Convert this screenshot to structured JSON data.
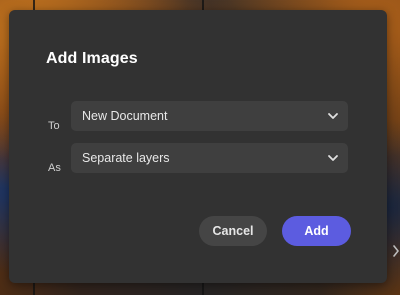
{
  "dialog": {
    "title": "Add Images",
    "fields": [
      {
        "label": "To",
        "value": "New Document",
        "icon": "chevron-down-icon"
      },
      {
        "label": "As",
        "value": "Separate layers",
        "icon": "chevron-down-icon"
      }
    ],
    "buttons": {
      "cancel_label": "Cancel",
      "add_label": "Add"
    }
  },
  "colors": {
    "dialog_bg": "#323232",
    "field_bg": "#3f3f3f",
    "cancel_bg": "#454545",
    "accent": "#5c5ce0"
  },
  "background": {
    "edge_icon": "chevron-right-icon"
  }
}
